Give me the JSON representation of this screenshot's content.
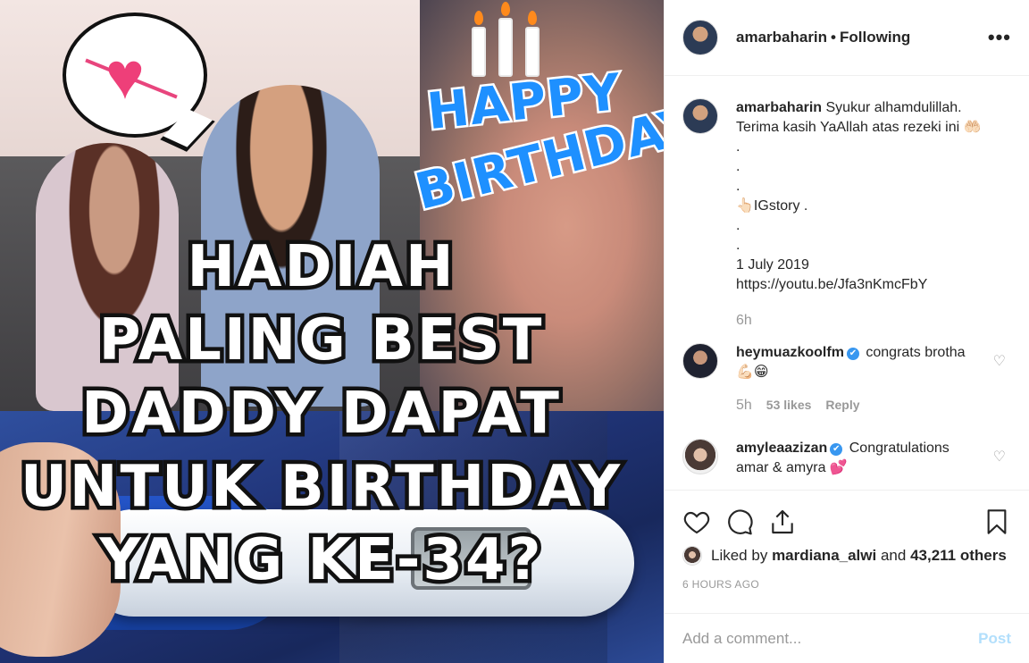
{
  "media": {
    "happy": "HAPPY",
    "birthday": "BIRTHDAY",
    "headline_lines": [
      "HADIAH",
      "PALING BEST",
      "DADDY DAPAT",
      "UNTUK BIRTHDAY",
      "YANG KE-34?"
    ]
  },
  "header": {
    "username": "amarbaharin",
    "separator": "•",
    "follow_status": "Following",
    "more": "•••"
  },
  "caption": {
    "username": "amarbaharin",
    "lines": [
      "Syukur alhamdulillah.",
      "Terima kasih YaAllah atas rezeki ini 🤲🏻",
      ".",
      ".",
      ".",
      "👆🏻IGstory .",
      ".",
      ".",
      "1 July 2019",
      "https://youtu.be/Jfa3nKmcFbY"
    ],
    "time": "6h"
  },
  "comments": [
    {
      "username": "heymuazkoolfm",
      "verified": "✔",
      "text": "congrats brotha 💪🏻😁",
      "time": "5h",
      "likes": "53 likes",
      "reply": "Reply"
    },
    {
      "username": "amyleaazizan",
      "verified": "✔",
      "text": "Congratulations amar & amyra 💕"
    }
  ],
  "likes": {
    "prefix": "Liked by",
    "user": "mardiana_alwi",
    "mid": "and",
    "others": "43,211 others"
  },
  "timestamp": "6 HOURS AGO",
  "add_comment": {
    "placeholder": "Add a comment...",
    "post": "Post"
  },
  "colors": {
    "accent_blue": "#3897f0",
    "post_disabled": "#b2dffc",
    "muted": "#999999"
  }
}
